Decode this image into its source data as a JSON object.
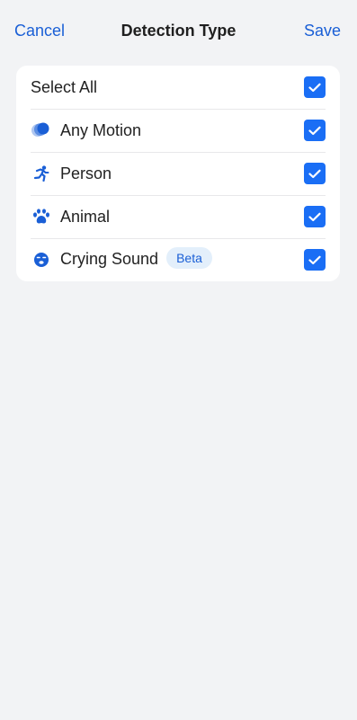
{
  "header": {
    "cancel_label": "Cancel",
    "title": "Detection Type",
    "save_label": "Save"
  },
  "options": {
    "select_all": {
      "label": "Select All",
      "checked": true
    },
    "items": [
      {
        "label": "Any Motion",
        "icon": "motion-icon",
        "checked": true
      },
      {
        "label": "Person",
        "icon": "person-running-icon",
        "checked": true
      },
      {
        "label": "Animal",
        "icon": "paw-icon",
        "checked": true
      },
      {
        "label": "Crying Sound",
        "icon": "crying-face-icon",
        "badge": "Beta",
        "checked": true
      }
    ]
  },
  "colors": {
    "accent": "#1a6ef5",
    "link": "#1a5fd6",
    "background": "#f2f3f5",
    "badge_bg": "#e3effb"
  }
}
